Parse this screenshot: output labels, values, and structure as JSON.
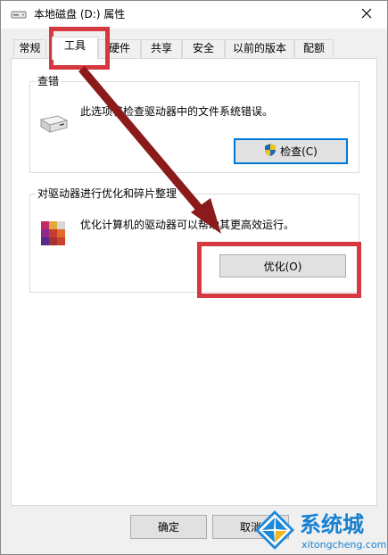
{
  "window": {
    "title": "本地磁盘 (D:) 属性",
    "close_icon": "close-icon"
  },
  "tabs": [
    {
      "label": "常规",
      "active": false
    },
    {
      "label": "工具",
      "active": true
    },
    {
      "label": "硬件",
      "active": false
    },
    {
      "label": "共享",
      "active": false
    },
    {
      "label": "安全",
      "active": false
    },
    {
      "label": "以前的版本",
      "active": false
    },
    {
      "label": "配额",
      "active": false
    }
  ],
  "error_check": {
    "title": "查错",
    "description": "此选项将检查驱动器中的文件系统错误。",
    "button_label": "检查(C)",
    "icon": "drive-icon",
    "button_icon": "shield-icon"
  },
  "optimize": {
    "title": "对驱动器进行优化和碎片整理",
    "description": "优化计算机的驱动器可以帮助其更高效运行。",
    "button_label": "优化(O)",
    "icon": "defrag-icon"
  },
  "footer": {
    "ok_label": "确定",
    "cancel_label": "取消"
  },
  "watermark": {
    "name": "系统城",
    "url": "xitongcheng.com"
  },
  "colors": {
    "highlight": "#d5393f",
    "arrow": "#8b1a1a",
    "focus": "#0078d7",
    "watermark": "#1780d0"
  }
}
